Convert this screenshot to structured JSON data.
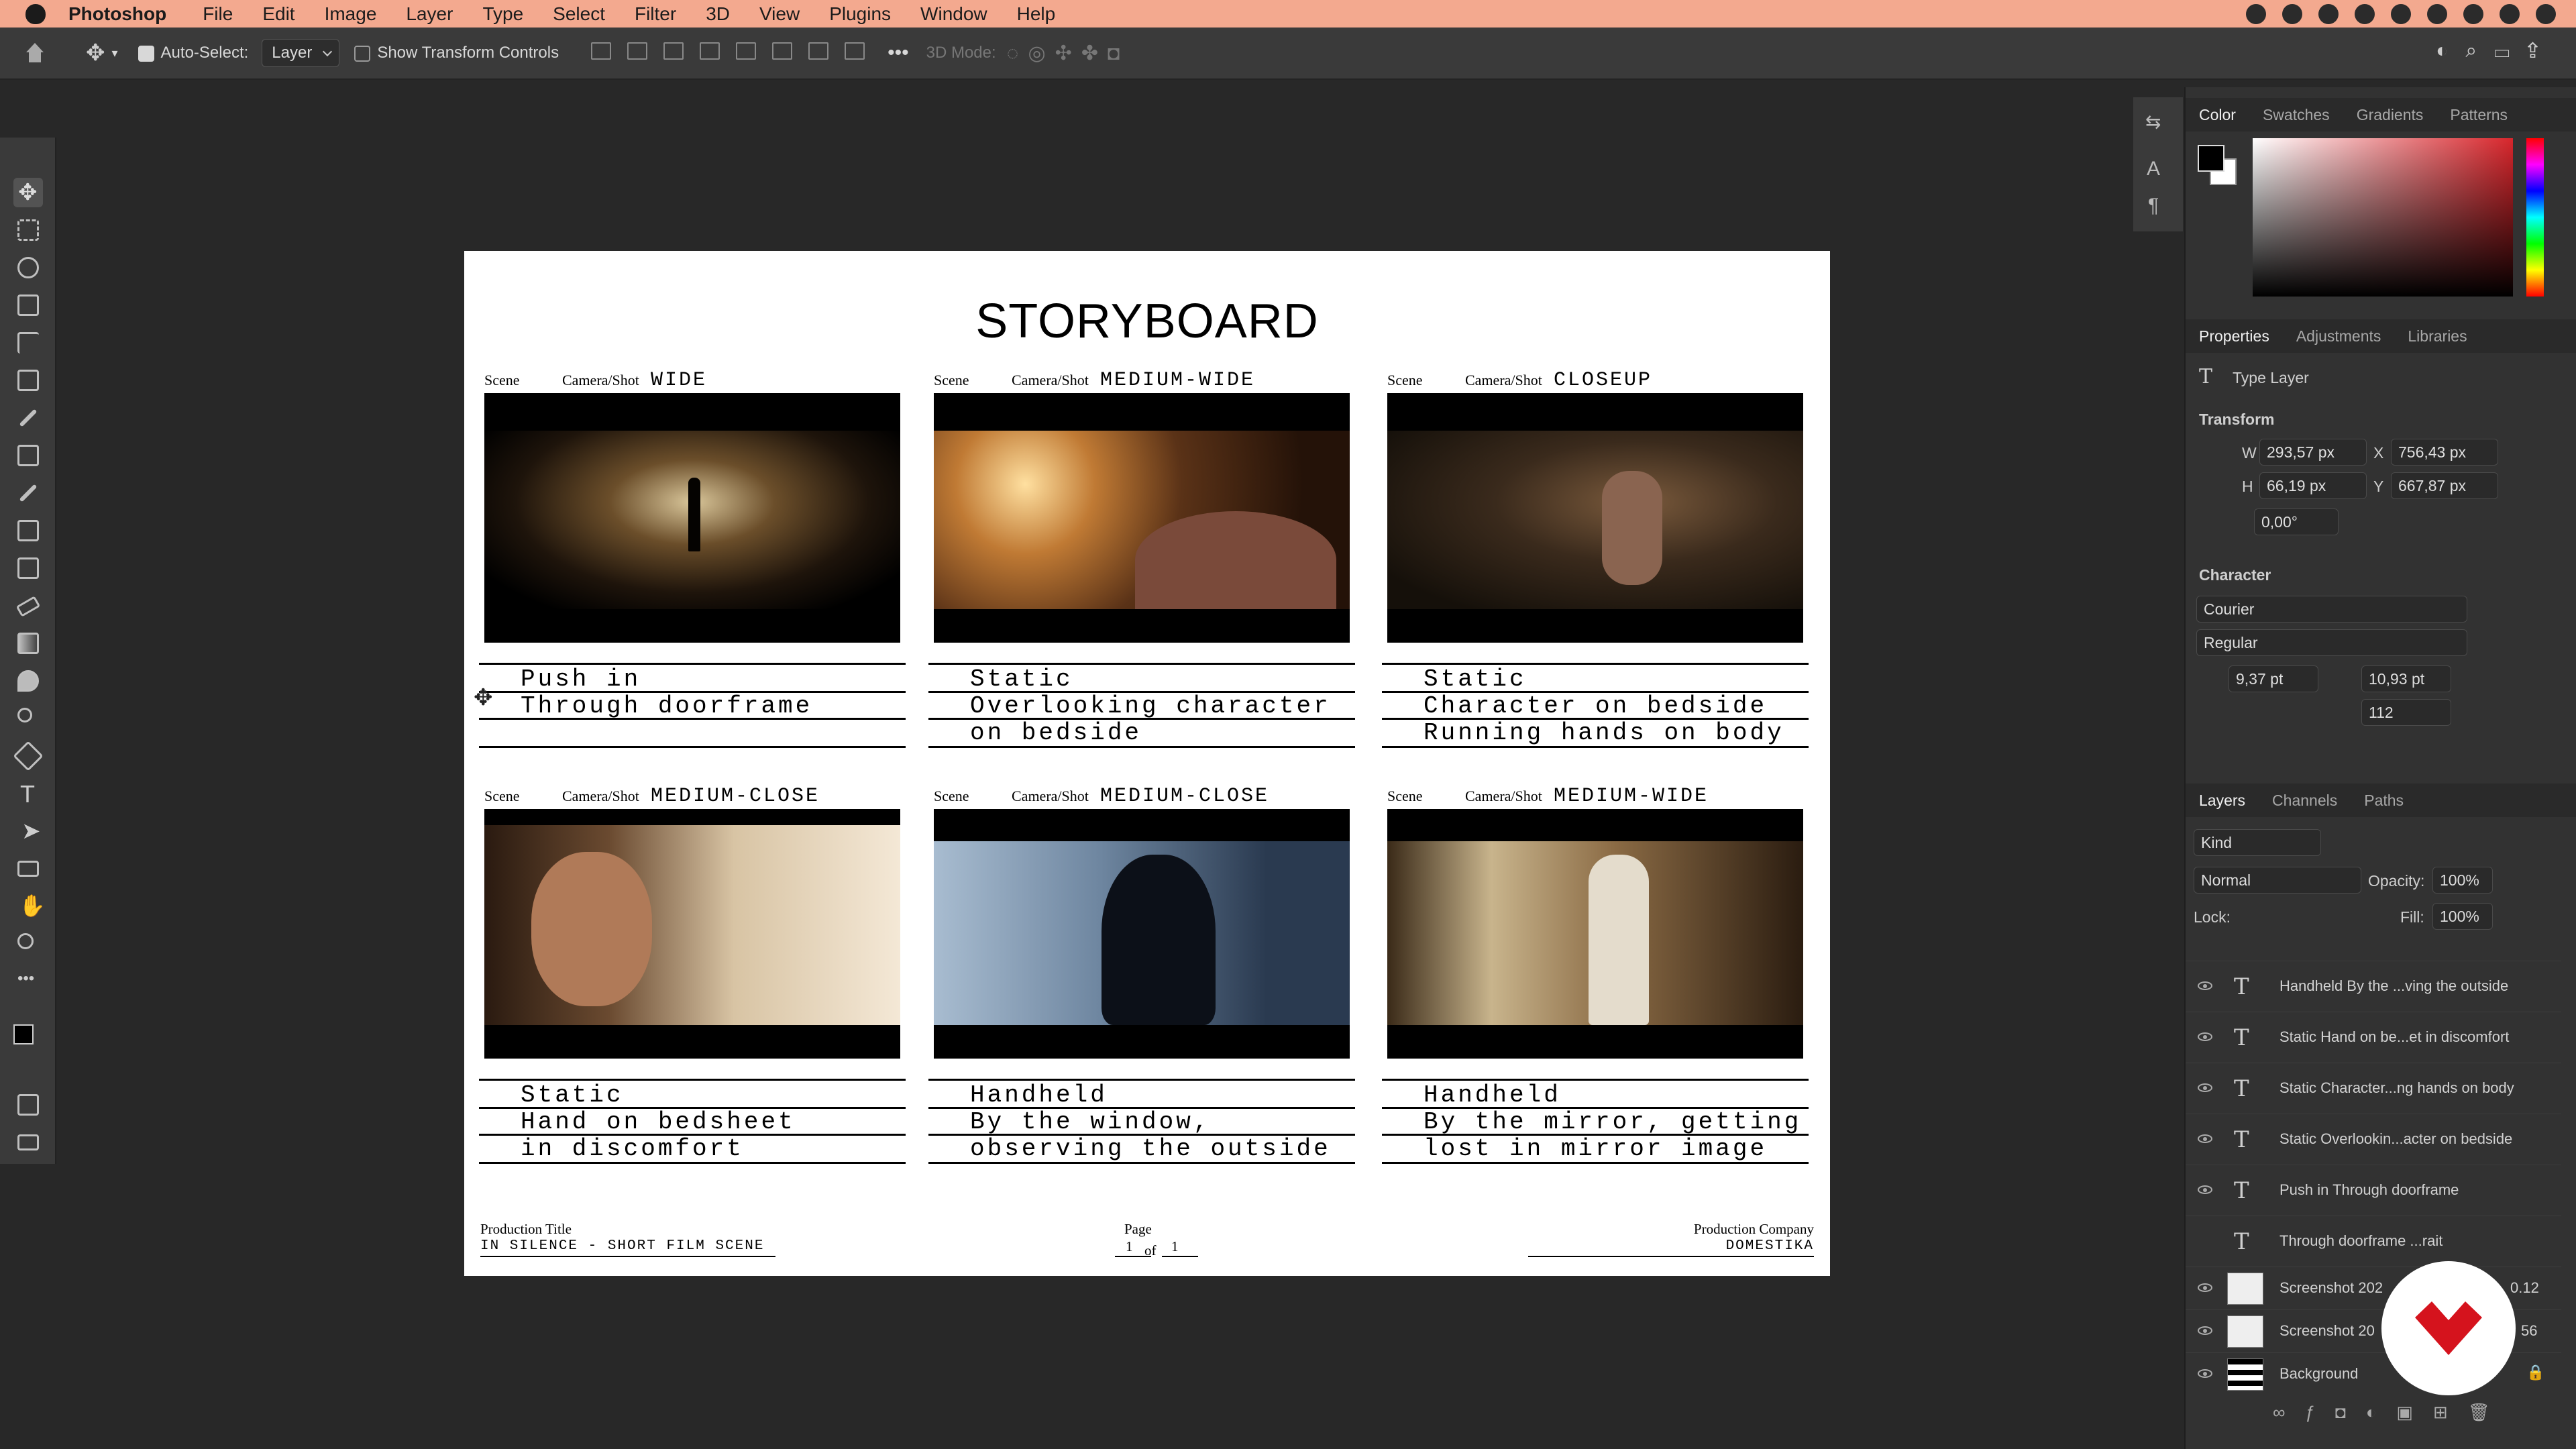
{
  "menubar": {
    "app": "Photoshop",
    "items": [
      "File",
      "Edit",
      "Image",
      "Layer",
      "Type",
      "Select",
      "Filter",
      "3D",
      "View",
      "Plugins",
      "Window",
      "Help"
    ]
  },
  "options": {
    "auto_select": "Auto-Select:",
    "auto_select_value": "Layer",
    "show_transform": "Show Transform Controls",
    "three_d_mode": "3D Mode:"
  },
  "document": {
    "title": "STORYBOARD",
    "scene_label": "Scene",
    "camera_label": "Camera/Shot",
    "panels": [
      {
        "shot": "WIDE",
        "lines": [
          "Push in",
          "Through doorframe",
          ""
        ]
      },
      {
        "shot": "MEDIUM-WIDE",
        "lines": [
          "Static",
          "Overlooking character",
          "on bedside"
        ]
      },
      {
        "shot": "CLOSEUP",
        "lines": [
          "Static",
          "Character on bedside",
          "Running hands on body"
        ]
      },
      {
        "shot": "MEDIUM-CLOSE",
        "lines": [
          "Static",
          "Hand on bedsheet",
          "in discomfort"
        ]
      },
      {
        "shot": "MEDIUM-CLOSE",
        "lines": [
          "Handheld",
          "By the window,",
          "observing the outside"
        ]
      },
      {
        "shot": "MEDIUM-WIDE",
        "lines": [
          "Handheld",
          "By the mirror, getting",
          "lost in mirror image"
        ]
      }
    ],
    "footer": {
      "prod_title_label": "Production Title",
      "prod_title": "IN SILENCE - SHORT FILM SCENE",
      "page_label": "Page",
      "page_num": "1",
      "of": "of",
      "page_total": "1",
      "company_label": "Production Company",
      "company": "DOMESTIKA"
    }
  },
  "color_panel": {
    "tabs": [
      "Color",
      "Swatches",
      "Gradients",
      "Patterns"
    ]
  },
  "properties": {
    "tabs": [
      "Properties",
      "Adjustments",
      "Libraries"
    ],
    "layer_type": "Type Layer",
    "transform": "Transform",
    "w_label": "W",
    "w": "293,57 px",
    "x_label": "X",
    "x": "756,43 px",
    "h_label": "H",
    "h": "66,19 px",
    "y_label": "Y",
    "y": "667,87 px",
    "angle": "0,00°",
    "character": "Character",
    "font": "Courier",
    "style": "Regular",
    "size": "9,37 pt",
    "leading": "10,93 pt",
    "tracking": "112"
  },
  "layers": {
    "tabs": [
      "Layers",
      "Channels",
      "Paths"
    ],
    "kind": "Kind",
    "blend": "Normal",
    "opacity_label": "Opacity:",
    "opacity": "100%",
    "lock_label": "Lock:",
    "fill_label": "Fill:",
    "fill": "100%",
    "items": [
      {
        "name": "Handheld By the ...ving the outside",
        "type": "text"
      },
      {
        "name": "Static Hand on be...et in discomfort",
        "type": "text"
      },
      {
        "name": "Static Character...ng hands on body",
        "type": "text"
      },
      {
        "name": "Static Overlookin...acter on bedside",
        "type": "text"
      },
      {
        "name": "Push in Through doorframe",
        "type": "text"
      },
      {
        "name": "Through doorframe   ...rait",
        "type": "text"
      },
      {
        "name": "Screenshot 202",
        "suffix": "0.12",
        "type": "image"
      },
      {
        "name": "Screenshot 20",
        "suffix": "56",
        "type": "image"
      },
      {
        "name": "Background",
        "type": "bg"
      }
    ]
  }
}
